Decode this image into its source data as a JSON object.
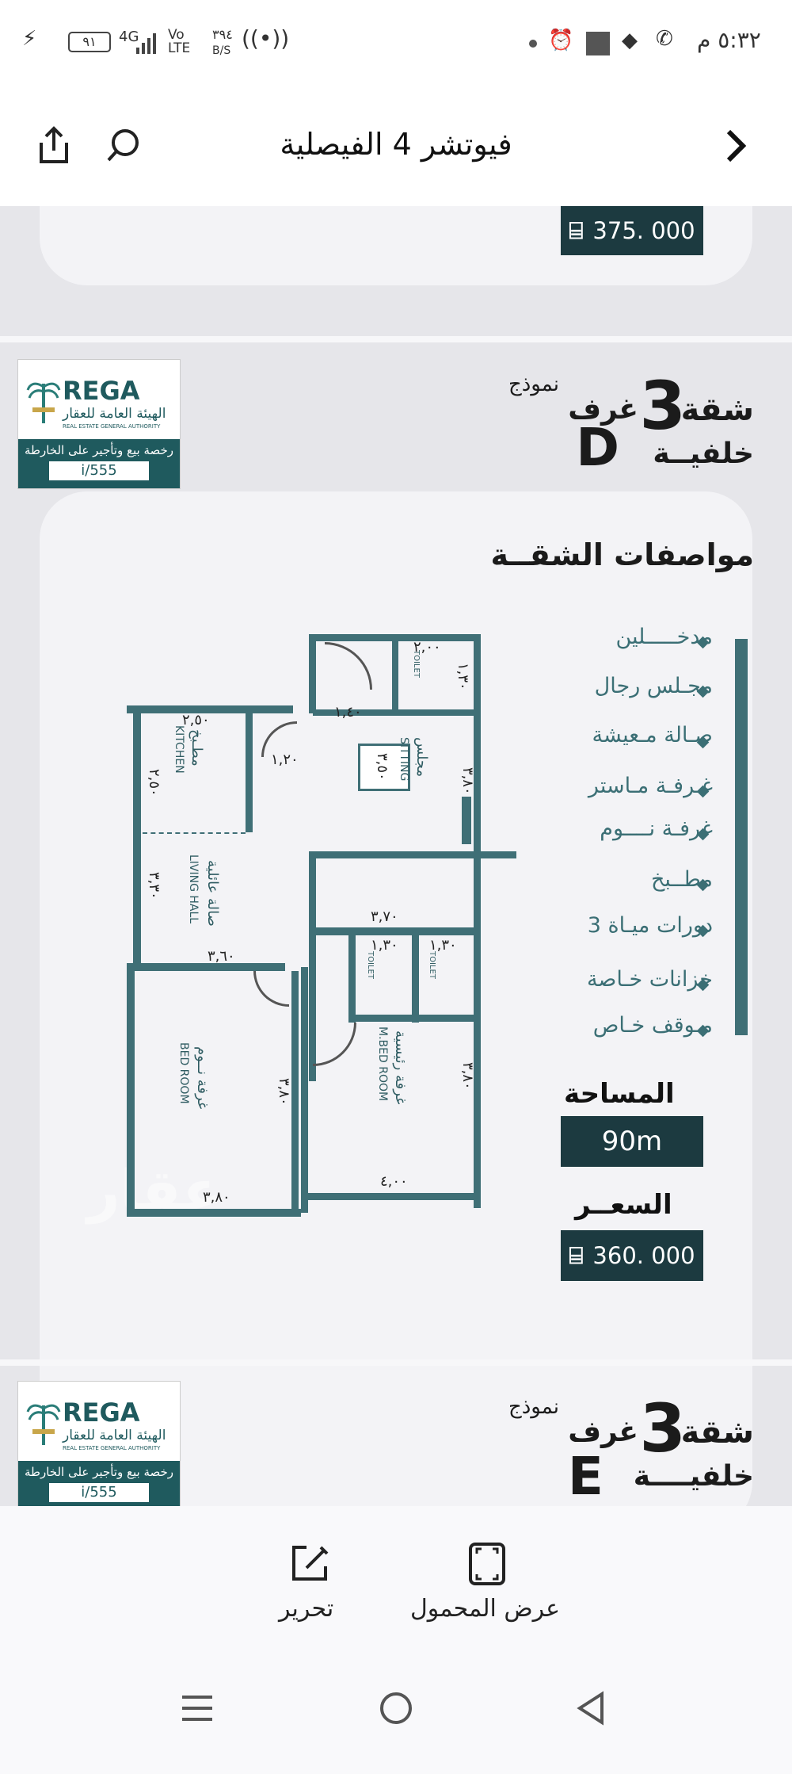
{
  "status_bar": {
    "time": "٥:٣٢ م",
    "network": "4G",
    "volte": "Vo LTE",
    "speed_value": "٣٩٤",
    "speed_unit": "B/S",
    "battery": "٩١"
  },
  "header": {
    "title": "فيوتشر 4 الفيصلية",
    "back_icon": "chevron-right-icon",
    "search_icon": "search-icon",
    "share_icon": "share-icon"
  },
  "prev_card": {
    "price": "375. 000"
  },
  "listing_d": {
    "rega": {
      "brand": "REGA",
      "arabic_name": "الهيئة العامة للعقار",
      "english_name": "REAL ESTATE GENERAL AUTHORITY",
      "license_title": "رخصة بيع وتأجير على الخارطة",
      "license_number": "i/555"
    },
    "model": {
      "apartment": "شقة",
      "rooms_number": "3",
      "rooms_word": "غرف",
      "model_word": "نموذج",
      "position": "خلفيــة",
      "letter": "D"
    },
    "specs_title": "مواصفات الشقــة",
    "specs": [
      "مدخـــــلين",
      "مجـلس رجال",
      "صـالة مـعيشة",
      "غـرفـة مـاستر",
      "غرفـة نــــوم",
      "مطــبخ",
      "3 دورات ميـاة",
      "خزانات خـاصة",
      "مـوقف خـاص"
    ],
    "area_label": "المساحة",
    "area_value": "90m",
    "price_label": "السعــر",
    "price_value": "360. 000",
    "watermark": "عقار",
    "plan": {
      "rooms": {
        "kitchen_ar": "مطـبخ",
        "kitchen_en": "KITCHEN",
        "living_ar": "صالة عائلية",
        "living_en": "LIVING HALL",
        "sitting_ar": "مجلس",
        "sitting_en": "SITTING",
        "bed_ar": "غرفة نــوم",
        "bed_en": "BED ROOM",
        "master_ar": "غرفة رئيسية",
        "master_en": "M.BED ROOM",
        "toilet": "TOILET"
      },
      "dims": {
        "d_kitchen_w": "٢,٥٠",
        "d_kitchen_h": "٢,٥٠",
        "d_door1": "١,٢٠",
        "d_entry": "١,٤٠",
        "d_toilet_top": "٢,٠٠",
        "d_toilet_side": "١,٣٠",
        "d_sitting_h": "٣,٨٠",
        "d_sitting_w": "٣,٧٠",
        "d_sitting_inner": "٣,٥٠",
        "d_living_h": "٣,٣٠",
        "d_living_w": "٣,٦٠",
        "d_t2": "١,٣٠",
        "d_t3": "١,٣٠",
        "d_bed_h": "٣,٨٠",
        "d_bed_w": "٣,٨٠",
        "d_master_h": "٣,٨٠",
        "d_master_w": "٤,٠٠"
      }
    }
  },
  "listing_e": {
    "rega": {
      "brand": "REGA",
      "arabic_name": "الهيئة العامة للعقار",
      "english_name": "REAL ESTATE GENERAL AUTHORITY",
      "license_title": "رخصة بيع وتأجير على الخارطة",
      "license_number": "i/555"
    },
    "model": {
      "apartment": "شقة",
      "rooms_number": "3",
      "rooms_word": "غرف",
      "model_word": "نموذج",
      "position": "خلفيــــة",
      "letter": "E"
    }
  },
  "toolbar": {
    "edit_label": "تحرير",
    "portable_label": "عرض المحمول"
  },
  "colors": {
    "dark_teal": "#1c3a40",
    "teal": "#3f6f76",
    "rega_green": "#1f5a5e"
  }
}
